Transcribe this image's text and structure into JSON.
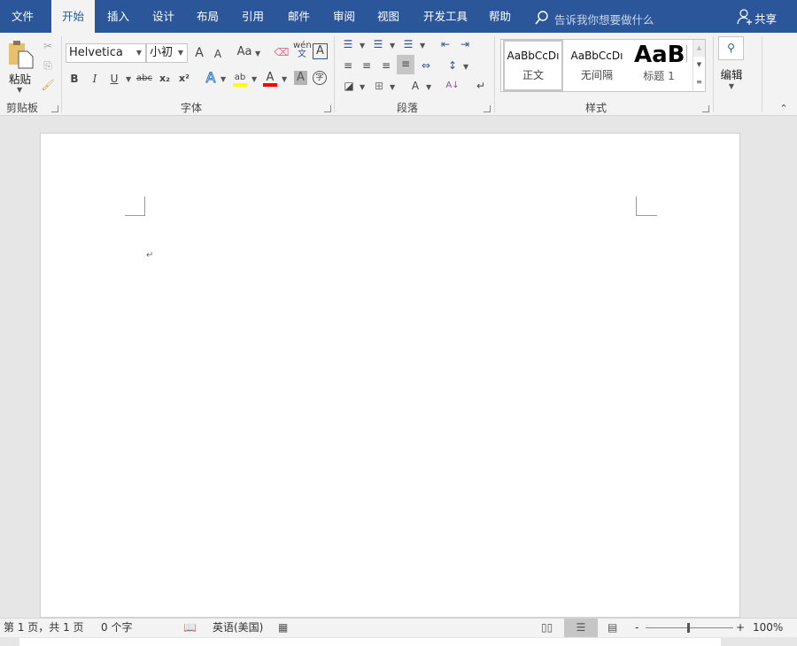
{
  "tabs": [
    "文件",
    "开始",
    "插入",
    "设计",
    "布局",
    "引用",
    "邮件",
    "审阅",
    "视图",
    "开发工具",
    "帮助"
  ],
  "active_tab": "开始",
  "search": {
    "placeholder": "告诉我你想要做什么"
  },
  "share_label": "共享",
  "clipboard": {
    "paste_label": "粘贴",
    "group_label": "剪贴板"
  },
  "font": {
    "name": "Helvetica",
    "size": "小初",
    "group_label": "字体",
    "grow": "A",
    "shrink": "A",
    "case": "Aa",
    "phonetic_top": "wén",
    "phonetic_bottom": "文",
    "bold": "B",
    "italic": "I",
    "underline": "U",
    "strike": "abc",
    "subscript": "x₂",
    "superscript": "x²",
    "enclose": "字"
  },
  "paragraph": {
    "group_label": "段落"
  },
  "styles": {
    "group_label": "样式",
    "items": [
      {
        "preview": "AaBbCcDı",
        "name": "正文"
      },
      {
        "preview": "AaBbCcDı",
        "name": "无间隔"
      },
      {
        "preview": "AaBl",
        "name": "标题 1"
      }
    ]
  },
  "editing": {
    "label": "编辑"
  },
  "colors": {
    "brand": "#2b579a",
    "highlight": "#ffff00",
    "font_color": "#ff0000"
  },
  "status": {
    "page": "第 1 页，共 1 页",
    "words": "0 个字",
    "language": "英语(美国)",
    "zoom": "100%",
    "zoom_percent": 100
  }
}
